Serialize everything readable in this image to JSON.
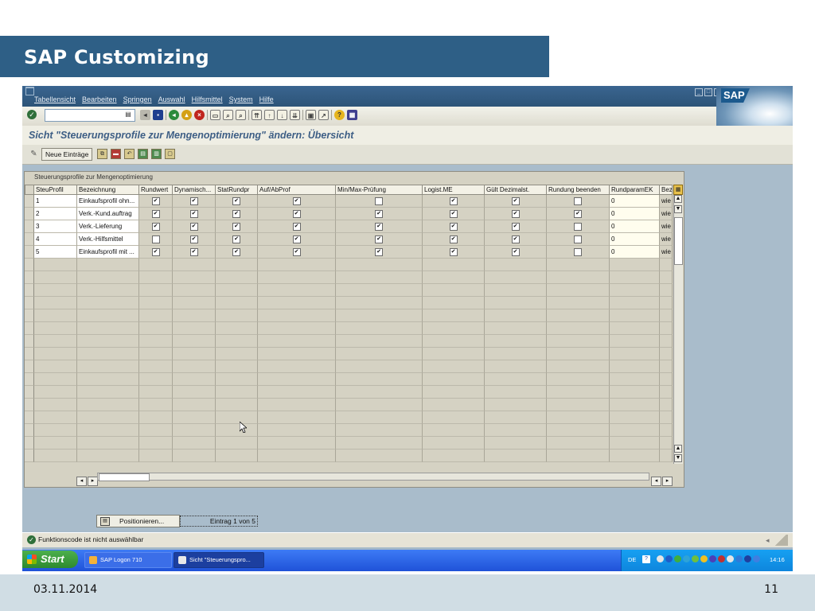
{
  "slide": {
    "title": "SAP Customizing",
    "date": "03.11.2014",
    "page_number": "11"
  },
  "menu": {
    "items": [
      "Tabellensicht",
      "Bearbeiten",
      "Springen",
      "Auswahl",
      "Hilfsmittel",
      "System",
      "Hilfe"
    ],
    "logo": "SAP"
  },
  "screen": {
    "title": "Sicht \"Steuerungsprofile zur Mengenoptimierung\" ändern: Übersicht",
    "new_entries_label": "Neue Einträge"
  },
  "table": {
    "caption": "Steuerungsprofile zur Mengenoptimierung",
    "columns": [
      "SteuProfil",
      "Bezeichnung",
      "Rundwert",
      "Dynamisch...",
      "StatRundpr",
      "Auf/AbProf",
      "Min/Max-Prüfung",
      "Logist.ME",
      "Gült Dezimalst.",
      "Rundung beenden",
      "RundparamEK",
      "Bez"
    ],
    "rows": [
      {
        "id": "1",
        "bezeichnung": "Einkaufsprofil ohn...",
        "rundwert": true,
        "dynamisch": true,
        "statrundpr": true,
        "aufab": true,
        "minmax": false,
        "logist": true,
        "gueltdez": true,
        "rundung": false,
        "rundparam": "0",
        "bez": "wie"
      },
      {
        "id": "2",
        "bezeichnung": "Verk.-Kund.auftrag",
        "rundwert": true,
        "dynamisch": true,
        "statrundpr": true,
        "aufab": true,
        "minmax": true,
        "logist": true,
        "gueltdez": true,
        "rundung": true,
        "rundparam": "0",
        "bez": "wie"
      },
      {
        "id": "3",
        "bezeichnung": "Verk.-Lieferung",
        "rundwert": true,
        "dynamisch": true,
        "statrundpr": true,
        "aufab": true,
        "minmax": true,
        "logist": true,
        "gueltdez": true,
        "rundung": false,
        "rundparam": "0",
        "bez": "wie"
      },
      {
        "id": "4",
        "bezeichnung": "Verk.-Hilfsmittel",
        "rundwert": false,
        "dynamisch": true,
        "statrundpr": true,
        "aufab": true,
        "minmax": true,
        "logist": true,
        "gueltdez": true,
        "rundung": false,
        "rundparam": "0",
        "bez": "wie"
      },
      {
        "id": "5",
        "bezeichnung": "Einkaufsprofil mit ...",
        "rundwert": true,
        "dynamisch": true,
        "statrundpr": true,
        "aufab": true,
        "minmax": true,
        "logist": true,
        "gueltdez": true,
        "rundung": false,
        "rundparam": "0",
        "bez": "wie"
      }
    ],
    "empty_rows": 16
  },
  "footer_controls": {
    "position_label": "Positionieren...",
    "entry_counter": "Eintrag 1 von 5"
  },
  "status": {
    "message": "Funktionscode ist nicht auswählbar"
  },
  "taskbar": {
    "start_label": "Start",
    "tasks": [
      "SAP Logon 710",
      "Sicht \"Steuerungspro..."
    ],
    "language": "DE",
    "clock": "14:16"
  }
}
